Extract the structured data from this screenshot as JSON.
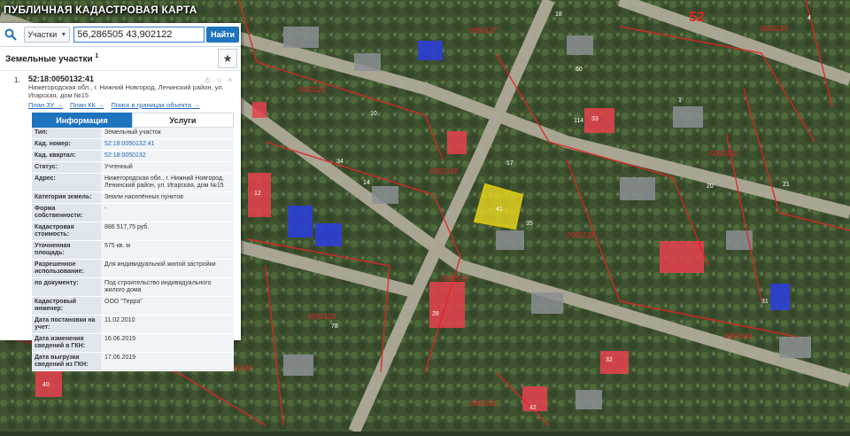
{
  "app": {
    "title": "ПУБЛИЧНАЯ КАДАСТРОВАЯ КАРТА"
  },
  "search": {
    "icon": "search-icon",
    "layer_select": "Участки",
    "query": "56,286505 43,902122",
    "find_label": "Найти"
  },
  "results": {
    "section_title": "Земельные участки",
    "count": "1",
    "favorite_icon": "star-icon",
    "item": {
      "num": "1.",
      "cad_number": "52:18:0050132:41",
      "address": "Нижегородская обл., г. Нижний Новгород, Ленинский район, ул. Игарская, дом №15",
      "tools": "⚠ ☆ ˄",
      "links": [
        "План ЗУ →",
        "План КК →",
        "Поиск в границах объекта →"
      ]
    },
    "tabs": [
      "Информация",
      "Услуги"
    ],
    "properties": [
      {
        "k": "Тип:",
        "v": "Земельный участок"
      },
      {
        "k": "Кад. номер:",
        "v": "52:18:0050132:41",
        "link": true
      },
      {
        "k": "Кад. квартал:",
        "v": "52:18:0050132",
        "link": true
      },
      {
        "k": "Статус:",
        "v": "Учтенный"
      },
      {
        "k": "Адрес:",
        "v": "Нижегородская обл., г. Нижний Новгород, Ленинский район, ул. Игарская, дом №15"
      },
      {
        "k": "Категория земель:",
        "v": "Земли населённых пунктов"
      },
      {
        "k": "Форма собственности:",
        "v": "-"
      },
      {
        "k": "Кадастровая стоимость:",
        "v": "886 517,75 руб."
      },
      {
        "k": "Уточненная площадь:",
        "v": "575 кв. м"
      },
      {
        "k": "Разрешенное использование:",
        "v": "Для индивидуальной жилой застройки"
      },
      {
        "k": "по документу:",
        "v": "Под строительство индивидуального жилого дома"
      },
      {
        "k": "Кадастровый инженер:",
        "v": "ООО \"Терра\""
      },
      {
        "k": "Дата постановки на учет:",
        "v": "11.02.2010"
      },
      {
        "k": "Дата изменения сведений в ГКН:",
        "v": "16.06.2019"
      },
      {
        "k": "Дата выгрузки сведений из ГКН:",
        "v": "17.06.2019"
      }
    ]
  },
  "map": {
    "region_label": "52",
    "quarter_labels": [
      "0050126",
      "0050127",
      "0050130",
      "0050126",
      "0050131",
      "0050132",
      "0050133",
      "0050125",
      "0050134",
      "0050135",
      "0050136",
      "0050138",
      "0050137"
    ],
    "lot_labels": [
      "18",
      "13",
      "14",
      "41",
      "12",
      "43",
      "33",
      "60",
      "10",
      "20",
      "32",
      "2",
      "40",
      "114",
      "28",
      "34",
      "35",
      "17",
      "42",
      "1",
      "21",
      "49",
      "31",
      "25",
      "37",
      "22",
      "23",
      "38",
      "3",
      "4",
      "19",
      "27",
      "78",
      "5",
      "15",
      "16"
    ],
    "colors": {
      "cadastre_line": "#e02424",
      "registered_lot": "#e8414d",
      "selected_lot": "#f5e01e",
      "buildings_blue": "#2c3fd6",
      "road": "#b9b3a5"
    }
  }
}
